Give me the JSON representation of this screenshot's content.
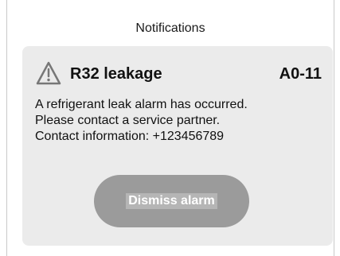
{
  "header": {
    "title": "Notifications"
  },
  "alarm": {
    "icon": "warning-triangle-icon",
    "title": "R32 leakage",
    "code": "A0-11",
    "message_lines": [
      "A refrigerant leak alarm has occurred.",
      "Please contact a service partner.",
      "Contact information: +123456789"
    ],
    "dismiss_label": "Dismiss alarm"
  },
  "colors": {
    "card_background": "#ebebeb",
    "button_background": "#9b9b9b",
    "button_label_highlight": "#b5b5b5",
    "text": "#111111",
    "icon_stroke": "#777777"
  }
}
